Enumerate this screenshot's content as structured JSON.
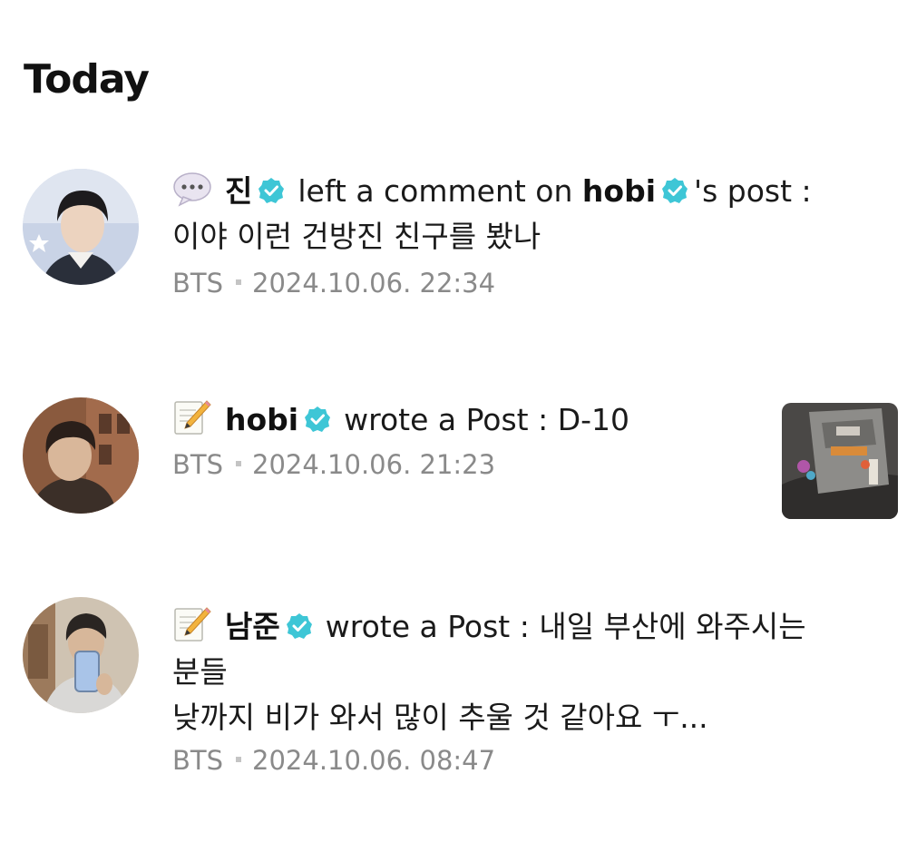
{
  "section": {
    "title": "Today"
  },
  "notifications": [
    {
      "icon": "speech-bubble-icon",
      "author": "진",
      "action_prefix": "left a comment on",
      "target": "hobi",
      "action_suffix": "'s post :",
      "line2": "이야 이런 건방진 친구를 봤나",
      "line3": "",
      "group": "BTS",
      "timestamp": "2024.10.06. 22:34"
    },
    {
      "icon": "memo-icon",
      "author": "hobi",
      "action_prefix": "wrote a Post : D-10",
      "group": "BTS",
      "timestamp": "2024.10.06. 21:23"
    },
    {
      "icon": "memo-icon",
      "author": "남준",
      "action_prefix": "wrote a Post : 내일 부산에 와주시는",
      "line2": "분들",
      "line3": "낮까지 비가 와서 많이 추울 것 같아요 ㅜ...",
      "group": "BTS",
      "timestamp": "2024.10.06. 08:47"
    }
  ],
  "colors": {
    "verified": "#3ec6d6",
    "meta_text": "#8a8a8a",
    "title": "#111111"
  }
}
